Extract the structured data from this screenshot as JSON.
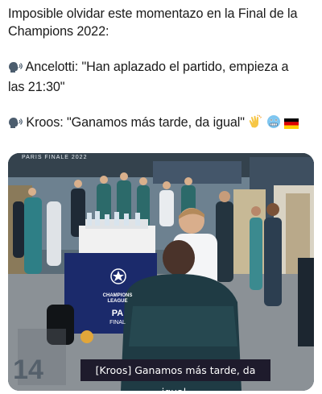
{
  "post": {
    "line1": "Imposible olvidar este momentazo en la Final de la",
    "line2": "Champions 2022:",
    "quote1_line1": "Ancelotti: \"Han aplazado el partido, empieza a",
    "quote1_line2": "las 21:30\"",
    "quote2": "Kroos: \"Ganamos más tarde, da igual\"",
    "speaking_icon": "speaking-head-icon",
    "clap_icon": "clapping-hands-icon",
    "cold_face_icon": "cold-face-icon",
    "flag_icon": "germany-flag-icon"
  },
  "media": {
    "wall_text": "PARIS FINALE 2022",
    "podium_line1": "CHAMPIONS",
    "podium_line2": "LEAGUE",
    "podium_city": "PA",
    "podium_final": "FINAL",
    "subtitle": "[Kroos] Ganamos más tarde, da igual.",
    "corner_number": "14"
  },
  "colors": {
    "germany_black": "#000000",
    "germany_red": "#dd0000",
    "germany_gold": "#ffce00",
    "subtitle_bg": "#1e1b2c",
    "podium_blue": "#1b2a6b"
  }
}
